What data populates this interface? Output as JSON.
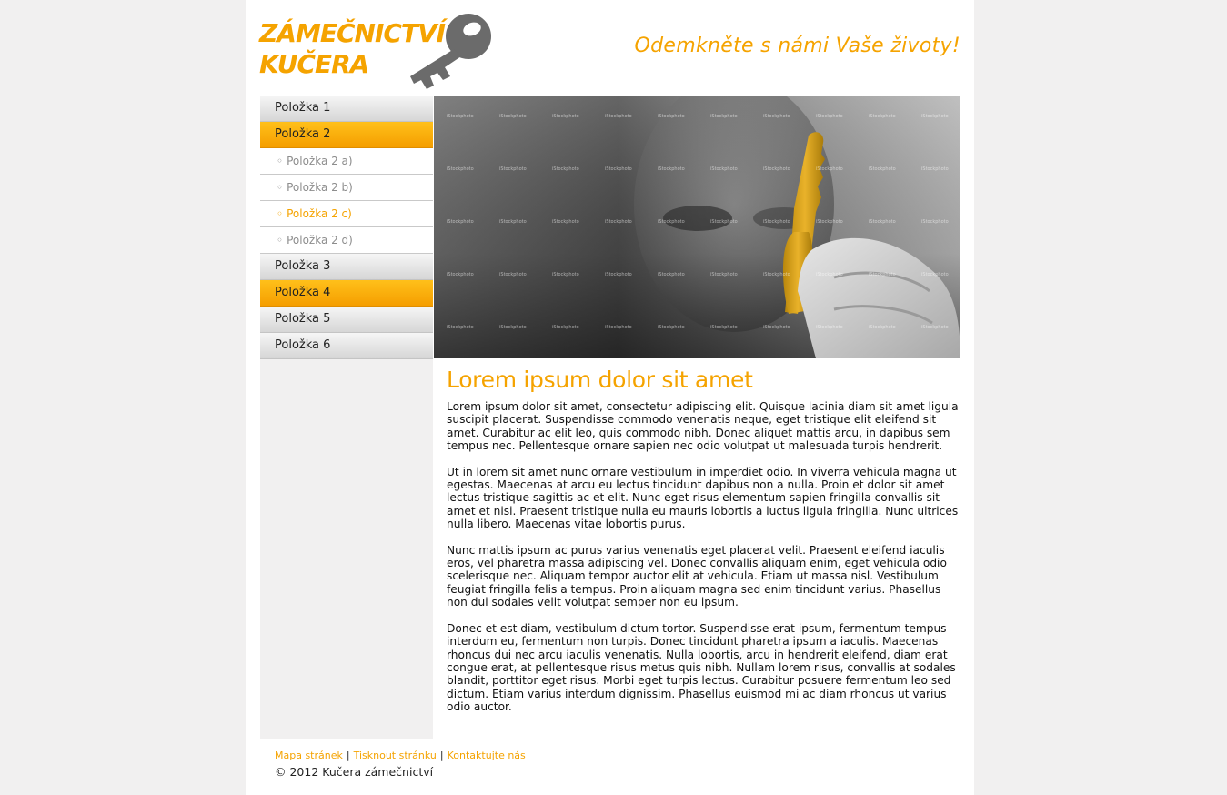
{
  "header": {
    "logo_line1": "ZÁMEČNICTVÍ",
    "logo_line2": "KUČERA",
    "slogan": "Odemkněte s námi Vaše životy!"
  },
  "nav": {
    "items": [
      {
        "label": "Položka 1",
        "active": false
      },
      {
        "label": "Položka 2",
        "active": true
      },
      {
        "label": "Položka 3",
        "active": false
      },
      {
        "label": "Položka 4",
        "active": true
      },
      {
        "label": "Položka 5",
        "active": false
      },
      {
        "label": "Položka 6",
        "active": false
      }
    ],
    "subitems": [
      {
        "label": "Položka 2 a)",
        "active": false
      },
      {
        "label": "Položka 2 b)",
        "active": false
      },
      {
        "label": "Položka 2 c)",
        "active": true
      },
      {
        "label": "Položka 2 d)",
        "active": false
      }
    ],
    "bullet": "◦"
  },
  "hero": {
    "watermark": "iStockphoto"
  },
  "content": {
    "heading": "Lorem ipsum dolor sit amet",
    "paragraphs": [
      "Lorem ipsum dolor sit amet, consectetur adipiscing elit. Quisque lacinia diam sit amet ligula suscipit placerat. Suspendisse commodo venenatis neque, eget tristique elit eleifend sit amet. Curabitur ac elit leo, quis commodo nibh. Donec aliquet mattis arcu, in dapibus sem tempus nec. Pellentesque ornare sapien nec odio volutpat ut malesuada turpis hendrerit.",
      "Ut in lorem sit amet nunc ornare vestibulum in imperdiet odio. In viverra vehicula magna ut egestas. Maecenas at arcu eu lectus tincidunt dapibus non a nulla. Proin et dolor sit amet lectus tristique sagittis ac et elit. Nunc eget risus elementum sapien fringilla convallis sit amet et nisi. Praesent tristique nulla eu mauris lobortis a luctus ligula fringilla. Nunc ultrices nulla libero. Maecenas vitae lobortis purus.",
      "Nunc mattis ipsum ac purus varius venenatis eget placerat velit. Praesent eleifend iaculis eros, vel pharetra massa adipiscing vel. Donec convallis aliquam enim, eget vehicula odio scelerisque nec. Aliquam tempor auctor elit at vehicula. Etiam ut massa nisl. Vestibulum feugiat fringilla felis a tempus. Proin aliquam magna sed enim tincidunt varius. Phasellus non dui sodales velit volutpat semper non eu ipsum.",
      "Donec et est diam, vestibulum dictum tortor. Suspendisse erat ipsum, fermentum tempus interdum eu, fermentum non turpis. Donec tincidunt pharetra ipsum a iaculis. Maecenas rhoncus dui nec arcu iaculis venenatis. Nulla lobortis, arcu in hendrerit eleifend, diam erat congue erat, at pellentesque risus metus quis nibh. Nullam lorem risus, convallis at sodales blandit, porttitor eget risus. Morbi eget turpis lectus. Curabitur posuere fermentum leo sed dictum. Etiam varius interdum dignissim. Phasellus euismod mi ac diam rhoncus ut varius odio auctor."
    ]
  },
  "footer": {
    "links": [
      "Mapa stránek",
      "Tisknout stránku",
      "Kontaktujte nás"
    ],
    "separator": "|",
    "copyright": "© 2012 Kučera zámečnictví"
  },
  "colors": {
    "accent": "#f5a300",
    "page_bg": "#f1f0f0",
    "key_grey": "#6b6b6b"
  }
}
